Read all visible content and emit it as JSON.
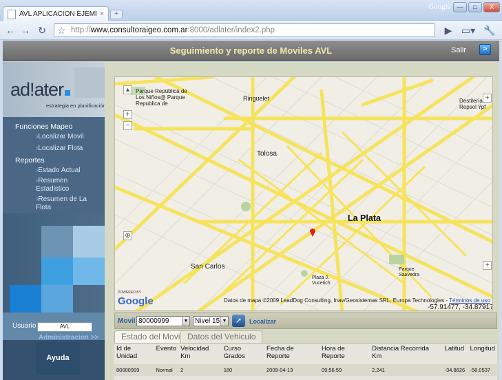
{
  "browser": {
    "tab_title": "AVL APLICACION EJEMPLO",
    "close": "×",
    "brand": "Google",
    "url_prefix": "http://",
    "url_host": "www.consultoraigeo.com.ar",
    "url_rest": ":8000/adlater/index2.php",
    "win_min": "—",
    "win_max": "□",
    "win_close": "X"
  },
  "header": {
    "title": "Seguimiento y reporte de Moviles AVL",
    "salir": "Salir",
    "salir_btn": ">"
  },
  "sidebar": {
    "logo_text": "ad!ater",
    "logo_tag": "estrategia en planificación",
    "section1": "Funciones Mapeo",
    "items1": [
      "Localizar Movil",
      "Localizar Flota"
    ],
    "section2": "Reportes",
    "items2": [
      "Estado Actual",
      "Resumen Estadistico",
      "Resumen de La Flota"
    ],
    "usuario_label": "Usuario",
    "usuario_value": "AVL",
    "admin": "Administracion >>",
    "ayuda": "Ayuda"
  },
  "map": {
    "labels": {
      "plaza_ninos": "Parque República de Los Niños@ Parque Republica de",
      "ringuelet": "Ringuelet",
      "destileria": "Destilería Repsol Ypf",
      "tolosa": "Tolosa",
      "laplata": "La Plata",
      "sancarlos": "San Carlos",
      "parque_saavedra": "Parque Saavedra",
      "plaza_vucetich": "Plaza J. Vucetich"
    },
    "credit": "Datos de mapa ©2009 LeadDog Consulting, Inav/Geosistemas SRL, Europa Technologies -",
    "terms": "Términos de uso",
    "coords": "-57.91477, -34.87917",
    "google_small": "POWERED BY",
    "google": "Google"
  },
  "controls": {
    "movil_label": "Movil",
    "movil_value": "80000999",
    "nivel_value": "Nivel 15",
    "localizar": "Localizar"
  },
  "tabs": [
    "Estado del Movil",
    "Datos del Vehiculo"
  ],
  "table": {
    "headers": [
      "Id de Unidad",
      "Evento",
      "Velocidad Km",
      "Curso Grados",
      "Fecha de Reporte",
      "Hora de Reporte",
      "Distancia Recorrida Km",
      "Latitud",
      "Longitud"
    ],
    "row": [
      "80000999",
      "Normal",
      "2",
      "180",
      "2009-04-13",
      "09:56:59",
      "2.241",
      "-34.8626",
      "-58.0537"
    ]
  }
}
